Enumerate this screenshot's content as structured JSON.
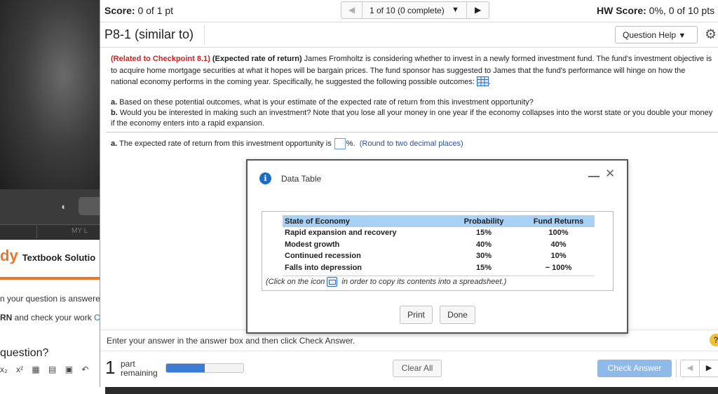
{
  "background_window": {
    "brand_logo": "dy",
    "brand_text": "Textbook Solutio",
    "tab_label": "MY L",
    "line1": "n your question is answere",
    "line2_bold": "RN",
    "line2_text": " and check your work ",
    "line2_link": "C",
    "question": "question?",
    "toolbar_icons": [
      "x₂",
      "x²",
      "▦",
      "▤",
      "▣",
      "↶"
    ]
  },
  "header": {
    "score_label": "Score:",
    "score_value": " 0 of 1 pt",
    "progress_text": "1 of 10 (0 complete)",
    "hw_score_label": "HW Score:",
    "hw_score_value": " 0%, 0 of 10 pts"
  },
  "problem": {
    "title": "P8-1 (similar to)",
    "help_button": "Question Help",
    "checkpoint": "(Related to Checkpoint 8.1)",
    "topic": "(Expected rate of return)",
    "body": " James Fromholtz is considering whether to invest in a newly formed investment fund.  The fund's investment objective is to acquire home mortgage securities at what it hopes will be bargain prices.  The fund sponsor has suggested to James that the fund's performance will hinge on how the national economy performs in the coming year.  Specifically, he suggested the following possible outcomes: ",
    "part_a_label": "a.",
    "part_a_text": " Based on these potential outcomes, what is your estimate of the expected rate of return from this investment opportunity?",
    "part_b_label": "b.",
    "part_b_text": " Would you be interested in making such an investment?  Note that you lose all your money in one year if the economy collapses into the worst state or you double your money if the economy enters into a rapid expansion.",
    "answer_label": "a.",
    "answer_prefix": " The expected rate of return from this investment opportunity is ",
    "answer_suffix": "%.",
    "answer_hint": "(Round to two decimal places)"
  },
  "dialog": {
    "title": "Data Table",
    "headers": [
      "State of Economy",
      "Probability",
      "Fund Returns"
    ],
    "rows": [
      [
        "Rapid expansion and recovery",
        "15%",
        "100%"
      ],
      [
        "Modest growth",
        "40%",
        "40%"
      ],
      [
        "Continued recession",
        "30%",
        "10%"
      ],
      [
        "Falls into depression",
        "15%",
        "− 100%"
      ]
    ],
    "note_prefix": "(Click on the icon",
    "note_suffix": " in order to copy its contents into a spreadsheet.)",
    "print_button": "Print",
    "done_button": "Done"
  },
  "footer": {
    "instruction": "Enter your answer in the answer box and then click Check Answer.",
    "parts_count": "1",
    "parts_label_1": "part",
    "parts_label_2": "remaining",
    "progress_fraction": 0.5,
    "clear_button": "Clear All",
    "check_button": "Check Answer"
  },
  "colors": {
    "accent_blue": "#3b7bd4",
    "checkpoint_red": "#d42020",
    "table_header": "#a9d0f5",
    "check_button": "#8fb9e8"
  }
}
